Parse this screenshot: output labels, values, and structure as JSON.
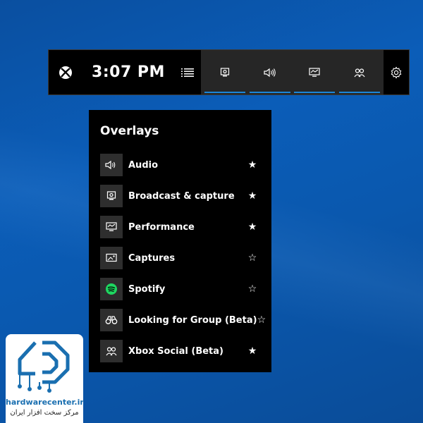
{
  "gamebar": {
    "time": "3:07 PM",
    "accent": "#1b86d8",
    "widgets": [
      {
        "icon": "broadcast-capture-icon"
      },
      {
        "icon": "audio-icon"
      },
      {
        "icon": "performance-icon"
      },
      {
        "icon": "xbox-social-icon"
      }
    ]
  },
  "overlays": {
    "title": "Overlays",
    "items": [
      {
        "label": "Audio",
        "icon": "audio-icon",
        "favorite": true
      },
      {
        "label": "Broadcast & capture",
        "icon": "broadcast-capture-icon",
        "favorite": true
      },
      {
        "label": "Performance",
        "icon": "performance-icon",
        "favorite": true
      },
      {
        "label": "Captures",
        "icon": "captures-icon",
        "favorite": false
      },
      {
        "label": "Spotify",
        "icon": "spotify-icon",
        "favorite": false
      },
      {
        "label": "Looking for Group (Beta)",
        "icon": "binoculars-icon",
        "favorite": false
      },
      {
        "label": "Xbox Social (Beta)",
        "icon": "xbox-social-icon",
        "favorite": true
      }
    ],
    "star_filled": "★",
    "star_empty": "☆"
  },
  "watermark": {
    "site": "hardwarecenter.ir",
    "subtitle": "مرکز سخت افزار ایران",
    "color": "#1a6fb0"
  }
}
